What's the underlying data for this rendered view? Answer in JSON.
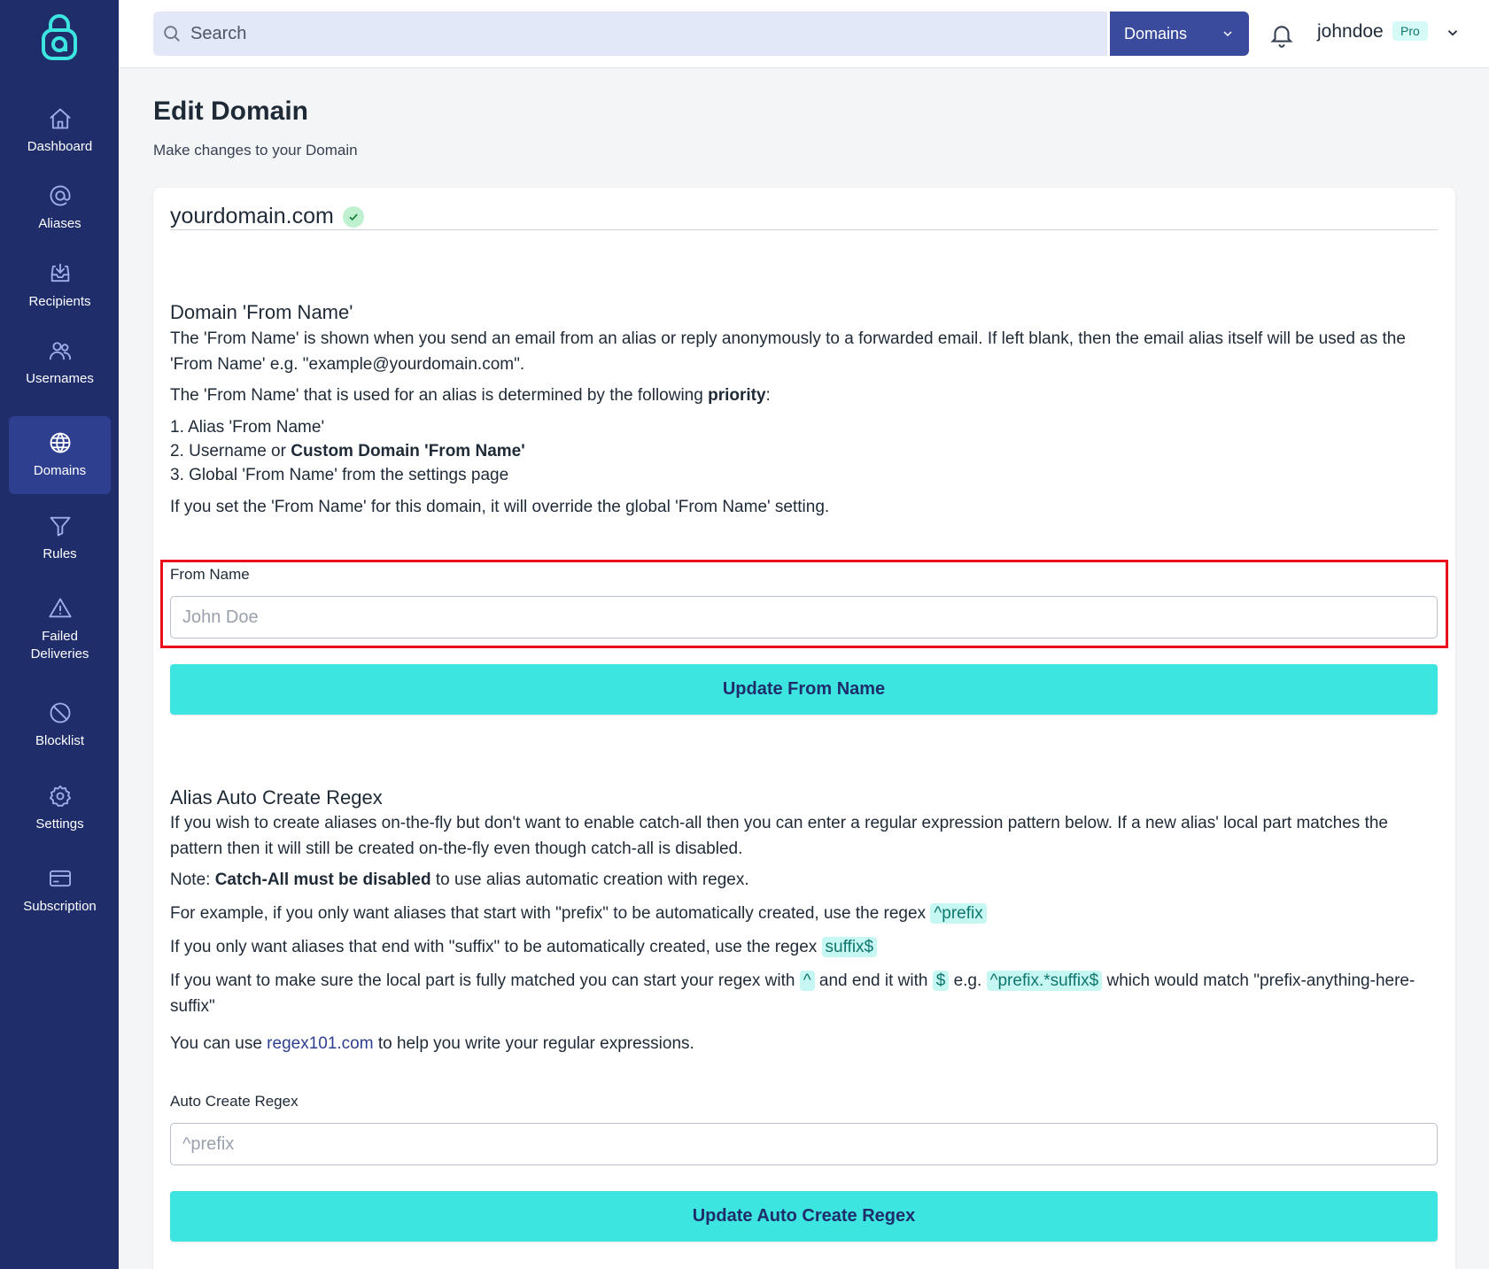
{
  "colors": {
    "sidebar": "#1f2d6b",
    "sidebar_active": "#2f3f8f",
    "accent": "#3ce5df",
    "highlight": "#e8101c"
  },
  "sidebar": {
    "items": [
      {
        "label": "Dashboard",
        "icon": "home-icon"
      },
      {
        "label": "Aliases",
        "icon": "at-sign-icon"
      },
      {
        "label": "Recipients",
        "icon": "inbox-icon"
      },
      {
        "label": "Usernames",
        "icon": "users-icon"
      },
      {
        "label": "Domains",
        "icon": "globe-icon",
        "active": true
      },
      {
        "label": "Rules",
        "icon": "filter-icon"
      },
      {
        "label": "Failed\nDeliveries",
        "icon": "warning-icon"
      },
      {
        "label": "Blocklist",
        "icon": "block-icon"
      },
      {
        "label": "Settings",
        "icon": "gear-icon"
      },
      {
        "label": "Subscription",
        "icon": "credit-card-icon"
      }
    ]
  },
  "header": {
    "search_placeholder": "Search",
    "search_scope": "Domains",
    "username": "johndoe",
    "plan_badge": "Pro"
  },
  "page": {
    "title": "Edit Domain",
    "subtitle": "Make changes to your Domain",
    "domain": "yourdomain.com"
  },
  "from_name": {
    "title": "Domain 'From Name'",
    "intro": "The 'From Name' is shown when you send an email from an alias or reply anonymously to a forwarded email. If left blank, then the email alias itself will be used as the 'From Name' e.g. \"example@yourdomain.com\".",
    "priority_prefix": "The 'From Name' that is used for an alias is determined by the following ",
    "priority_bold": "priority",
    "priority_suffix": ":",
    "list_1": "1. Alias 'From Name'",
    "list_2_prefix": "2. Username or ",
    "list_2_bold": "Custom Domain 'From Name'",
    "list_3": "3. Global 'From Name' from the settings page",
    "override_note": "If you set the 'From Name' for this domain, it will override the global 'From Name' setting.",
    "field_label": "From Name",
    "field_placeholder": "John Doe",
    "field_value": "",
    "button": "Update From Name"
  },
  "regex": {
    "title": "Alias Auto Create Regex",
    "intro": "If you wish to create aliases on-the-fly but don't want to enable catch-all then you can enter a regular expression pattern below. If a new alias' local part matches the pattern then it will still be created on-the-fly even though catch-all is disabled.",
    "note_prefix": "Note: ",
    "note_bold": "Catch-All must be disabled",
    "note_suffix": " to use alias automatic creation with regex.",
    "example_prefix": "For example, if you only want aliases that start with \"prefix\" to be automatically created, use the regex ",
    "example_code": "^prefix",
    "suffix_prefix": "If you only want aliases that end with \"suffix\" to be automatically created, use the regex ",
    "suffix_code": "suffix$",
    "full_1": "If you want to make sure the local part is fully matched you can start your regex with ",
    "full_code_1": "^",
    "full_2": " and end it with ",
    "full_code_2": "$",
    "full_3": " e.g. ",
    "full_code_3": "^prefix.*suffix$",
    "full_4": " which would match \"prefix-anything-here-suffix\"",
    "help_prefix": "You can use ",
    "help_link": "regex101.com",
    "help_suffix": " to help you write your regular expressions.",
    "field_label": "Auto Create Regex",
    "field_placeholder": "^prefix",
    "field_value": "",
    "button": "Update Auto Create Regex"
  }
}
